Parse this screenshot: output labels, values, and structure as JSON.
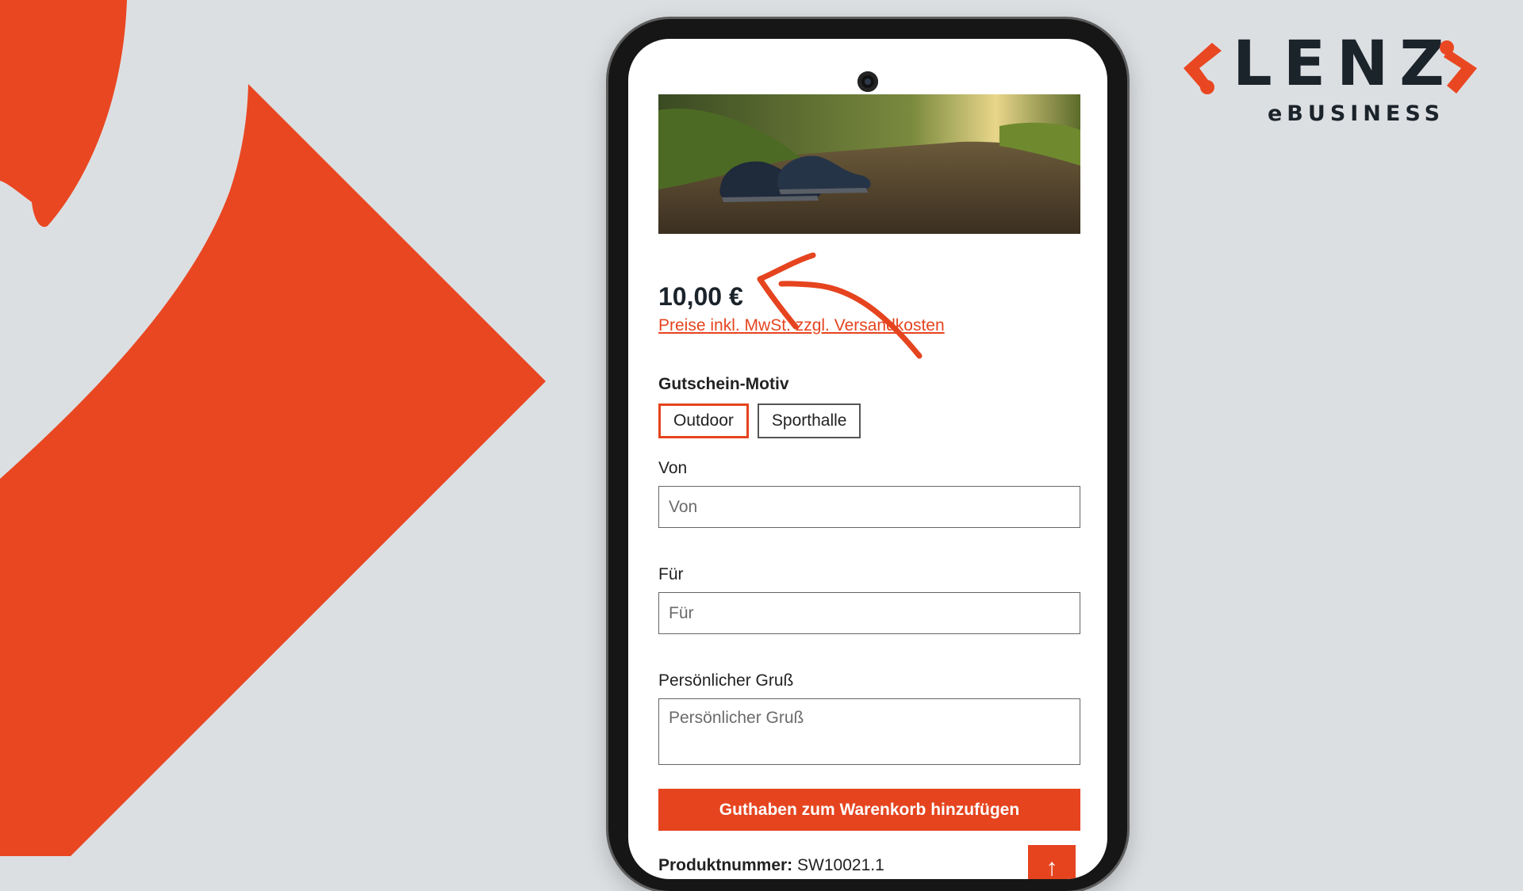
{
  "brand": {
    "name": "LENZ",
    "tagline": "eBUSINESS",
    "accent_color": "#e5441f",
    "text_color": "#1b232b"
  },
  "product": {
    "image_icon": "trail-running-shoes-photo",
    "price": "10,00 €",
    "tax_note": "Preise inkl. MwSt. zzgl. Versandkosten"
  },
  "form": {
    "motif_label": "Gutschein-Motiv",
    "motif_options": [
      "Outdoor",
      "Sporthalle"
    ],
    "motif_selected": "Outdoor",
    "from_label": "Von",
    "from_placeholder": "Von",
    "to_label": "Für",
    "to_placeholder": "Für",
    "greeting_label": "Persönlicher Gruß",
    "greeting_placeholder": "Persönlicher Gruß",
    "add_to_cart": "Guthaben zum Warenkorb hinzufügen"
  },
  "meta": {
    "sku_label": "Produktnummer:",
    "sku_value": "SW10021.1",
    "scroll_top_icon": "arrow-up-icon"
  }
}
